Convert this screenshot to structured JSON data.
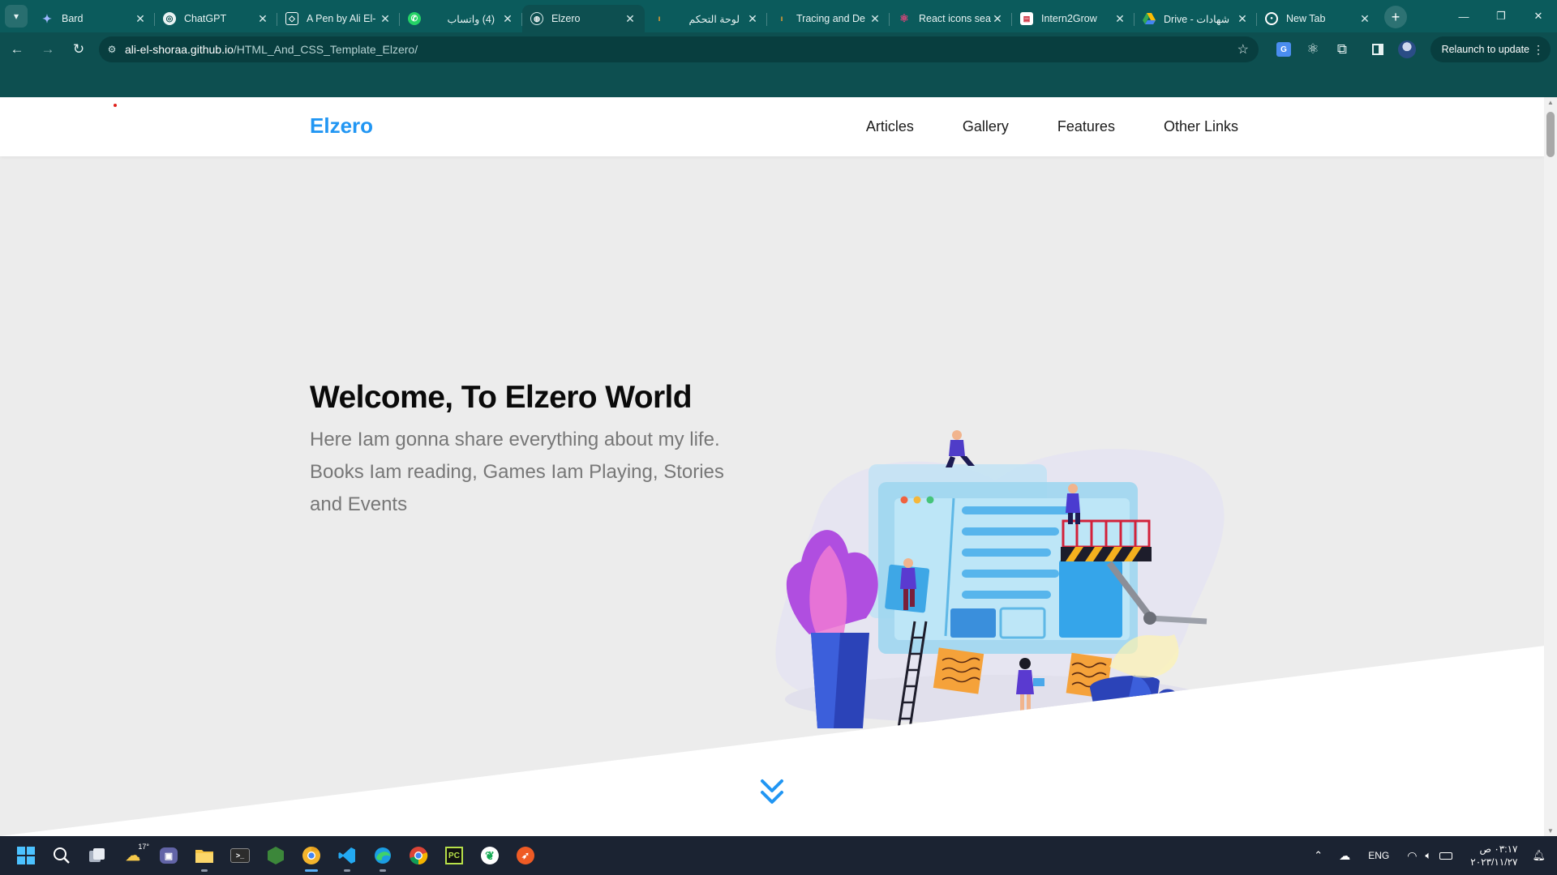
{
  "browser": {
    "tabs": [
      {
        "title": "Bard",
        "favicon": "bard-icon",
        "active": false
      },
      {
        "title": "ChatGPT",
        "favicon": "chatgpt-icon",
        "active": false
      },
      {
        "title": "A Pen by Ali El-",
        "favicon": "codepen-icon",
        "active": false
      },
      {
        "title": "(4) واتساب",
        "favicon": "whatsapp-icon",
        "active": false
      },
      {
        "title": "Elzero",
        "favicon": "globe-icon",
        "active": true
      },
      {
        "title": "لوحة التحكم",
        "favicon": "torch-icon",
        "active": false
      },
      {
        "title": "Tracing and De",
        "favicon": "torch-icon",
        "active": false
      },
      {
        "title": "React icons sea",
        "favicon": "react-icon",
        "active": false
      },
      {
        "title": "Intern2Grow",
        "favicon": "doc-icon",
        "active": false
      },
      {
        "title": "Drive - شهادات",
        "favicon": "drive-icon",
        "active": false
      },
      {
        "title": "New Tab",
        "favicon": "chrome-icon",
        "active": false
      }
    ],
    "address": {
      "host": "ali-el-shoraa.github.io",
      "path": "/HTML_And_CSS_Template_Elzero/"
    },
    "relaunch_label": "Relaunch to update",
    "translate_label": "G",
    "theme_color": "#0b5b5c"
  },
  "site": {
    "logo": "Elzero",
    "logo_color": "#2196f3",
    "nav": [
      "Articles",
      "Gallery",
      "Features",
      "Other Links"
    ],
    "hero": {
      "title": "Welcome, To Elzero World",
      "description": "Here Iam gonna share everything about my life. Books Iam reading, Games Iam Playing, Stories and Events"
    },
    "illustration": "people-building-website-illustration",
    "scroll_icon": "double-chevron-down-icon"
  },
  "taskbar": {
    "apps": [
      "windows-start-icon",
      "search-icon",
      "task-view-icon",
      "weather-widget-icon",
      "teams-icon",
      "file-explorer-icon",
      "terminal-icon",
      "nodejs-icon",
      "chrome-canary-icon",
      "vscode-icon",
      "edge-icon",
      "chrome-icon",
      "pycharm-icon",
      "mongodb-compass-icon",
      "postman-icon"
    ],
    "weather_temp": "17°",
    "language": "ENG",
    "time": "٠٣:١٧ ص",
    "date": "٢٠٢٣/١١/٢٧"
  }
}
